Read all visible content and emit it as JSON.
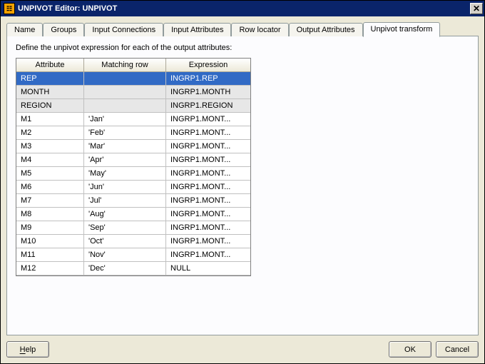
{
  "window": {
    "title": "UNPIVOT Editor: UNPIVOT"
  },
  "tabs": {
    "items": [
      {
        "label": "Name",
        "active": false
      },
      {
        "label": "Groups",
        "active": false
      },
      {
        "label": "Input Connections",
        "active": false
      },
      {
        "label": "Input Attributes",
        "active": false
      },
      {
        "label": "Row locator",
        "active": false
      },
      {
        "label": "Output Attributes",
        "active": false
      },
      {
        "label": "Unpivot transform",
        "active": true
      }
    ]
  },
  "panel": {
    "instruction": "Define the unpivot expression for each of the output attributes:"
  },
  "grid": {
    "headers": {
      "attribute": "Attribute",
      "matching": "Matching row",
      "expression": "Expression"
    },
    "rows": [
      {
        "attribute": "REP",
        "matching": "",
        "expression": "INGRP1.REP",
        "selected": true,
        "shaded": false
      },
      {
        "attribute": "MONTH",
        "matching": "",
        "expression": "INGRP1.MONTH",
        "selected": false,
        "shaded": true
      },
      {
        "attribute": "REGION",
        "matching": "",
        "expression": "INGRP1.REGION",
        "selected": false,
        "shaded": true
      },
      {
        "attribute": "M1",
        "matching": "'Jan'",
        "expression": "INGRP1.MONT...",
        "selected": false,
        "shaded": false
      },
      {
        "attribute": "M2",
        "matching": "'Feb'",
        "expression": "INGRP1.MONT...",
        "selected": false,
        "shaded": false
      },
      {
        "attribute": "M3",
        "matching": "'Mar'",
        "expression": "INGRP1.MONT...",
        "selected": false,
        "shaded": false
      },
      {
        "attribute": "M4",
        "matching": "'Apr'",
        "expression": "INGRP1.MONT...",
        "selected": false,
        "shaded": false
      },
      {
        "attribute": "M5",
        "matching": "'May'",
        "expression": "INGRP1.MONT...",
        "selected": false,
        "shaded": false
      },
      {
        "attribute": "M6",
        "matching": "'Jun'",
        "expression": "INGRP1.MONT...",
        "selected": false,
        "shaded": false
      },
      {
        "attribute": "M7",
        "matching": "'Jul'",
        "expression": "INGRP1.MONT...",
        "selected": false,
        "shaded": false
      },
      {
        "attribute": "M8",
        "matching": "'Aug'",
        "expression": "INGRP1.MONT...",
        "selected": false,
        "shaded": false
      },
      {
        "attribute": "M9",
        "matching": "'Sep'",
        "expression": "INGRP1.MONT...",
        "selected": false,
        "shaded": false
      },
      {
        "attribute": "M10",
        "matching": "'Oct'",
        "expression": "INGRP1.MONT...",
        "selected": false,
        "shaded": false
      },
      {
        "attribute": "M11",
        "matching": "'Nov'",
        "expression": "INGRP1.MONT...",
        "selected": false,
        "shaded": false
      },
      {
        "attribute": "M12",
        "matching": "'Dec'",
        "expression": "NULL",
        "selected": false,
        "shaded": false
      }
    ]
  },
  "buttons": {
    "help": "Help",
    "ok": "OK",
    "cancel": "Cancel"
  }
}
